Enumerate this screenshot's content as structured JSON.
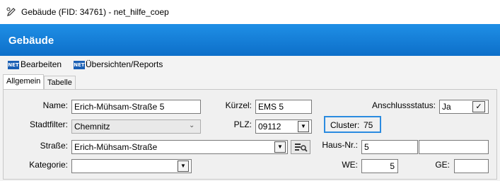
{
  "window": {
    "title": "Gebäude (FID: 34761) - net_hilfe_coep",
    "icon": "pencil-edit-icon"
  },
  "header": {
    "title": "Gebäude"
  },
  "toolbar": {
    "edit_icon_text": "NET",
    "edit_label": "Bearbeiten",
    "reports_icon_text": "NET",
    "reports_label": "Übersichten/Reports"
  },
  "tabs": [
    {
      "label": "Allgemein",
      "active": true
    },
    {
      "label": "Tabelle",
      "active": false
    }
  ],
  "form": {
    "name_label": "Name:",
    "name_value": "Erich-Mühsam-Straße 5",
    "kuerzel_label": "Kürzel:",
    "kuerzel_value": "EMS 5",
    "anschlussstatus_label": "Anschlussstatus:",
    "anschlussstatus_value": "Ja",
    "stadtfilter_label": "Stadtfilter:",
    "stadtfilter_value": "Chemnitz",
    "plz_label": "PLZ:",
    "plz_value": "09112",
    "cluster_label": "Cluster:",
    "cluster_value": "75",
    "strasse_label": "Straße:",
    "strasse_value": "Erich-Mühsam-Straße",
    "hausnr_label": "Haus-Nr.:",
    "hausnr_value": "5",
    "hausnr_suffix_value": "",
    "kategorie_label": "Kategorie:",
    "kategorie_value": "",
    "we_label": "WE:",
    "we_value": "5",
    "ge_label": "GE:",
    "ge_value": ""
  }
}
